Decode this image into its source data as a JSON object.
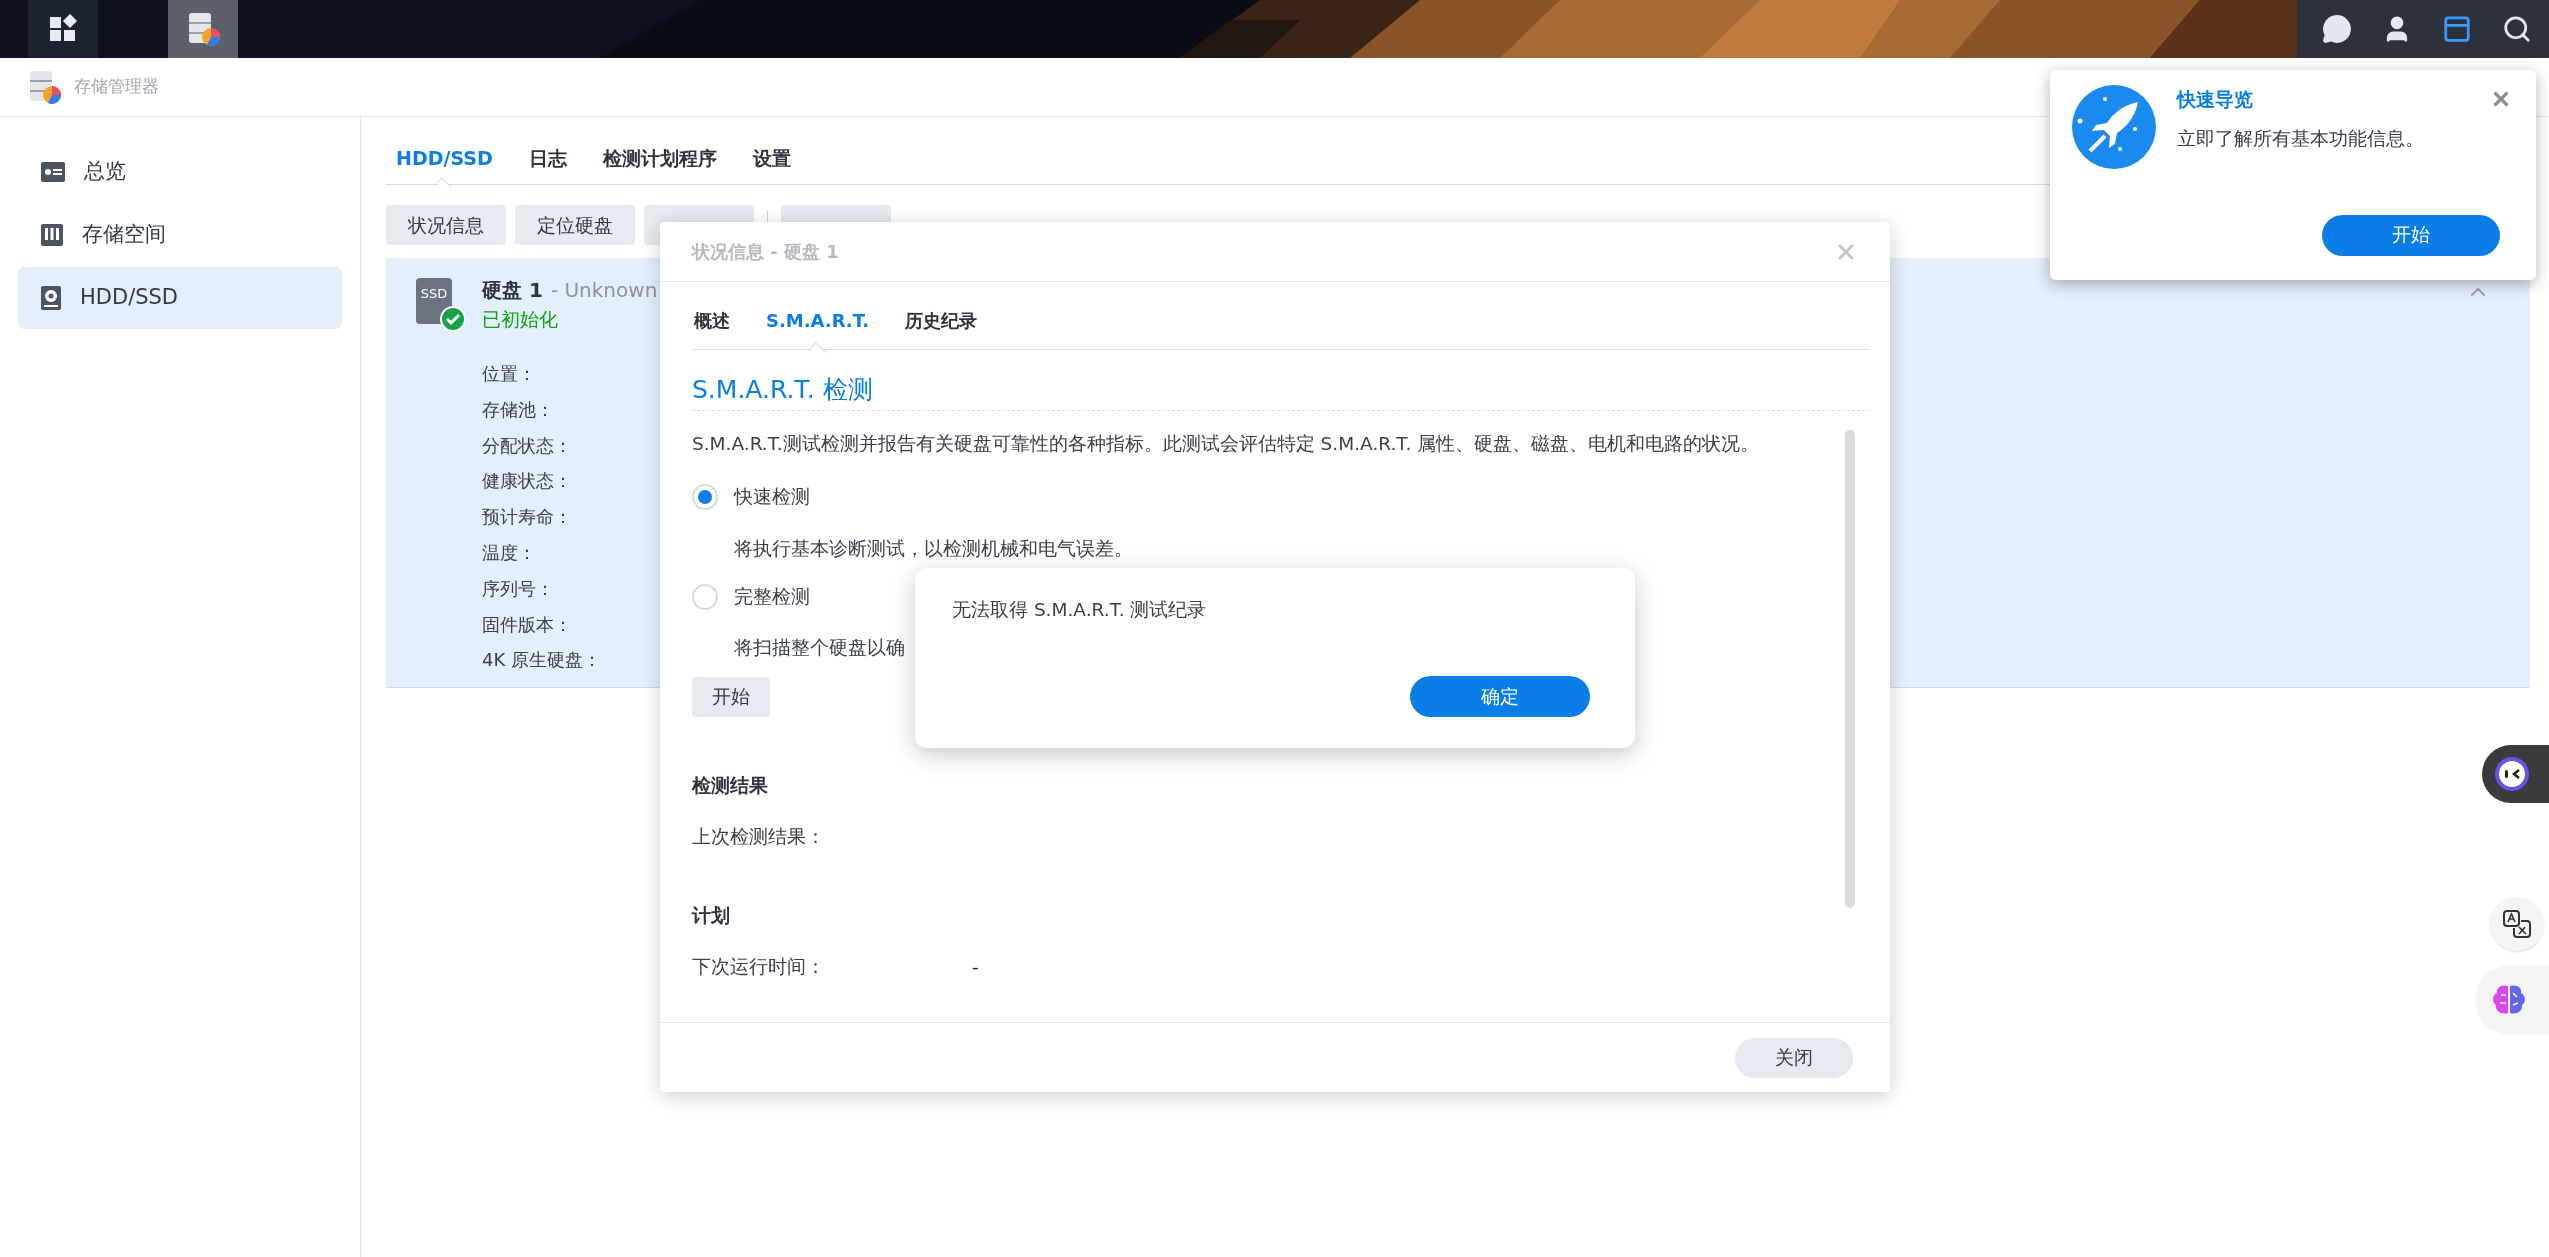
{
  "taskbar": {
    "apps": [
      {
        "kind": "grid",
        "selected": false
      },
      {
        "kind": "storage",
        "selected": true
      }
    ],
    "tray": [
      {
        "kind": "chat",
        "selected": false
      },
      {
        "kind": "user",
        "selected": false
      },
      {
        "kind": "widgets",
        "selected": true
      },
      {
        "kind": "search",
        "selected": false
      }
    ]
  },
  "window": {
    "title": "存储管理器"
  },
  "sidebar": {
    "items": [
      {
        "kind": "overview",
        "label": "总览",
        "selected": false
      },
      {
        "kind": "storage",
        "label": "存储空间",
        "selected": false
      },
      {
        "kind": "disk",
        "label": "HDD/SSD",
        "selected": true
      }
    ]
  },
  "tabs": [
    {
      "label": "HDD/SSD",
      "selected": true
    },
    {
      "label": "日志",
      "selected": false
    },
    {
      "label": "检测计划程序",
      "selected": false
    },
    {
      "label": "设置",
      "selected": false
    }
  ],
  "toolbar": {
    "buttons": [
      {
        "label": "状况信息",
        "covered": false
      },
      {
        "label": "定位硬盘",
        "covered": false
      },
      {
        "covered": true
      },
      {
        "covered": true
      }
    ]
  },
  "disk": {
    "icon_label": "SSD",
    "name": "硬盘 1",
    "model": "- Unknown",
    "status": "已初始化",
    "healthy": true,
    "expanded": true,
    "fields": [
      "位置：",
      "存储池：",
      "分配状态：",
      "健康状态：",
      "预计寿命：",
      "温度：",
      "序列号：",
      "固件版本：",
      "4K 原生硬盘："
    ]
  },
  "dialog": {
    "title": "状况信息 - 硬盘 1",
    "tabs": [
      {
        "label": "概述",
        "selected": false
      },
      {
        "label": "S.M.A.R.T.",
        "selected": true
      },
      {
        "label": "历史纪录",
        "selected": false
      }
    ],
    "heading": "S.M.A.R.T. 检测",
    "description": "S.M.A.R.T.测试检测并报告有关硬盘可靠性的各种指标。此测试会评估特定 S.M.A.R.T. 属性、硬盘、磁盘、电机和电路的状况。",
    "options": [
      {
        "label": "快速检测",
        "hint": "将执行基本诊断测试，以检测机械和电气误差。",
        "selected": true
      },
      {
        "label": "完整检测",
        "hint": "将扫描整个硬盘以确",
        "selected": false
      }
    ],
    "start_button": "开始",
    "sections": [
      {
        "heading": "检测结果",
        "rows": [
          {
            "label": "上次检测结果："
          }
        ]
      },
      {
        "heading": "计划",
        "rows": [
          {
            "label": "下次运行时间：",
            "value": "-"
          }
        ]
      }
    ],
    "close_button": "关闭"
  },
  "alert": {
    "message": "无法取得 S.M.A.R.T. 测试纪录",
    "ok_button": "确定"
  },
  "tour": {
    "title": "快速导览",
    "message": "立即了解所有基本功能信息。",
    "button": "开始"
  }
}
